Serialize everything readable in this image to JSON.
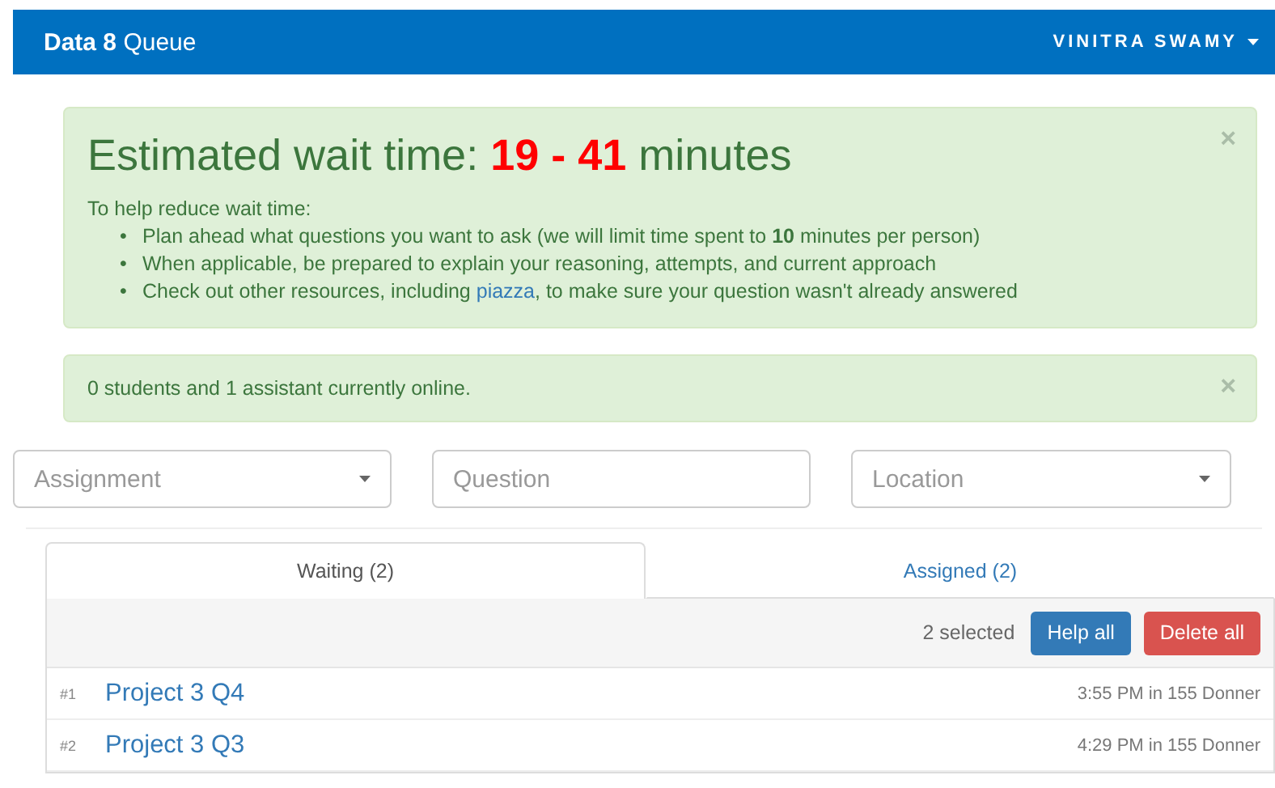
{
  "navbar": {
    "brand_bold": "Data 8",
    "brand": "Queue",
    "user": "VINITRA SWAMY"
  },
  "wait_alert": {
    "title_before": "Estimated wait time:",
    "range": "19 - 41",
    "title_after": "minutes",
    "intro": "To help reduce wait time:",
    "close": "×",
    "tips": [
      {
        "bullet": "•",
        "segments": [
          {
            "kind": "text",
            "text": "Plan ahead what questions you want to ask (we will limit time spent to **10** minutes per person)"
          }
        ]
      },
      {
        "bullet": "•",
        "segments": [
          {
            "kind": "text",
            "text": "When applicable, be prepared to explain your reasoning, attempts, and current approach"
          }
        ]
      },
      {
        "bullet": "•",
        "segments": [
          {
            "kind": "text",
            "text": "Check out other resources, including "
          },
          {
            "kind": "link",
            "text": "piazza"
          },
          {
            "kind": "text",
            "text": ", to make sure your question wasn't already answered"
          }
        ]
      }
    ]
  },
  "online_alert": {
    "text": "0 students and 1 assistant currently online.",
    "close": "×"
  },
  "filters": [
    {
      "kind": "select",
      "placeholder": "Assignment"
    },
    {
      "kind": "input",
      "placeholder": "Question"
    },
    {
      "kind": "select",
      "placeholder": "Location"
    }
  ],
  "tabs": [
    {
      "label": "Waiting (2)",
      "selected": true
    },
    {
      "label": "Assigned (2)",
      "selected": false
    }
  ],
  "toolbar": {
    "selected_count": "2 selected",
    "buttons": [
      {
        "label": "Help all",
        "kind": "primary"
      },
      {
        "label": "Delete all",
        "kind": "danger"
      }
    ]
  },
  "rows": [
    {
      "index": "#1",
      "title": "Project 3 Q4",
      "meta": "3:55 PM in 155 Donner"
    },
    {
      "index": "#2",
      "title": "Project 3 Q3",
      "meta": "4:29 PM in 155 Donner"
    }
  ]
}
